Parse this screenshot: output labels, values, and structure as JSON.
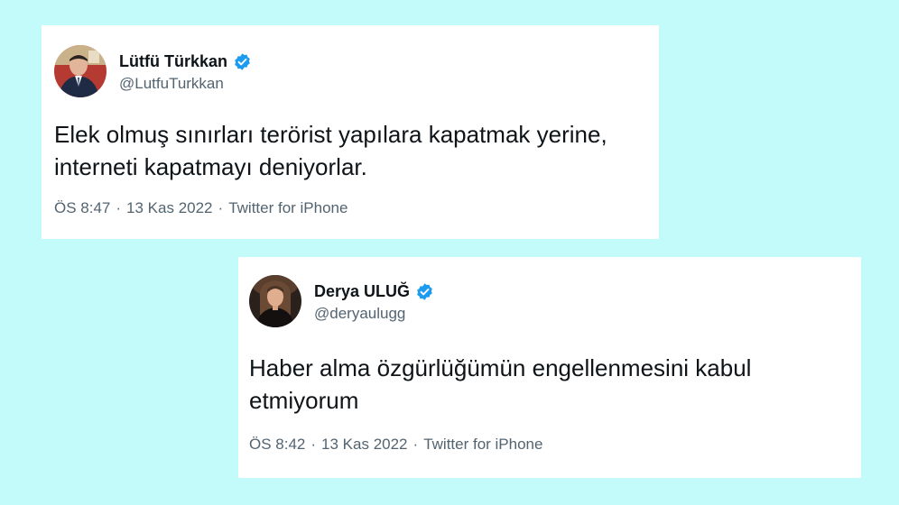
{
  "colors": {
    "background": "#c3fafa",
    "card": "#ffffff",
    "text_primary": "#0f1419",
    "text_secondary": "#536471",
    "verified_badge": "#1d9bf0"
  },
  "tweets": [
    {
      "display_name": "Lütfü Türkkan",
      "handle": "@LutfuTurkkan",
      "verified": true,
      "text": "Elek olmuş sınırları terörist yapılara kapatmak yerine,\ninterneti kapatmayı deniyorlar.",
      "time": "ÖS 8:47",
      "date": "13 Kas 2022",
      "source": "Twitter for iPhone",
      "separator": "·"
    },
    {
      "display_name": "Derya ULUĞ",
      "handle": "@deryaulugg",
      "verified": true,
      "text": "Haber alma özgürlüğümün engellenmesini kabul\netmiyorum",
      "time": "ÖS 8:42",
      "date": "13 Kas 2022",
      "source": "Twitter for iPhone",
      "separator": "·"
    }
  ]
}
